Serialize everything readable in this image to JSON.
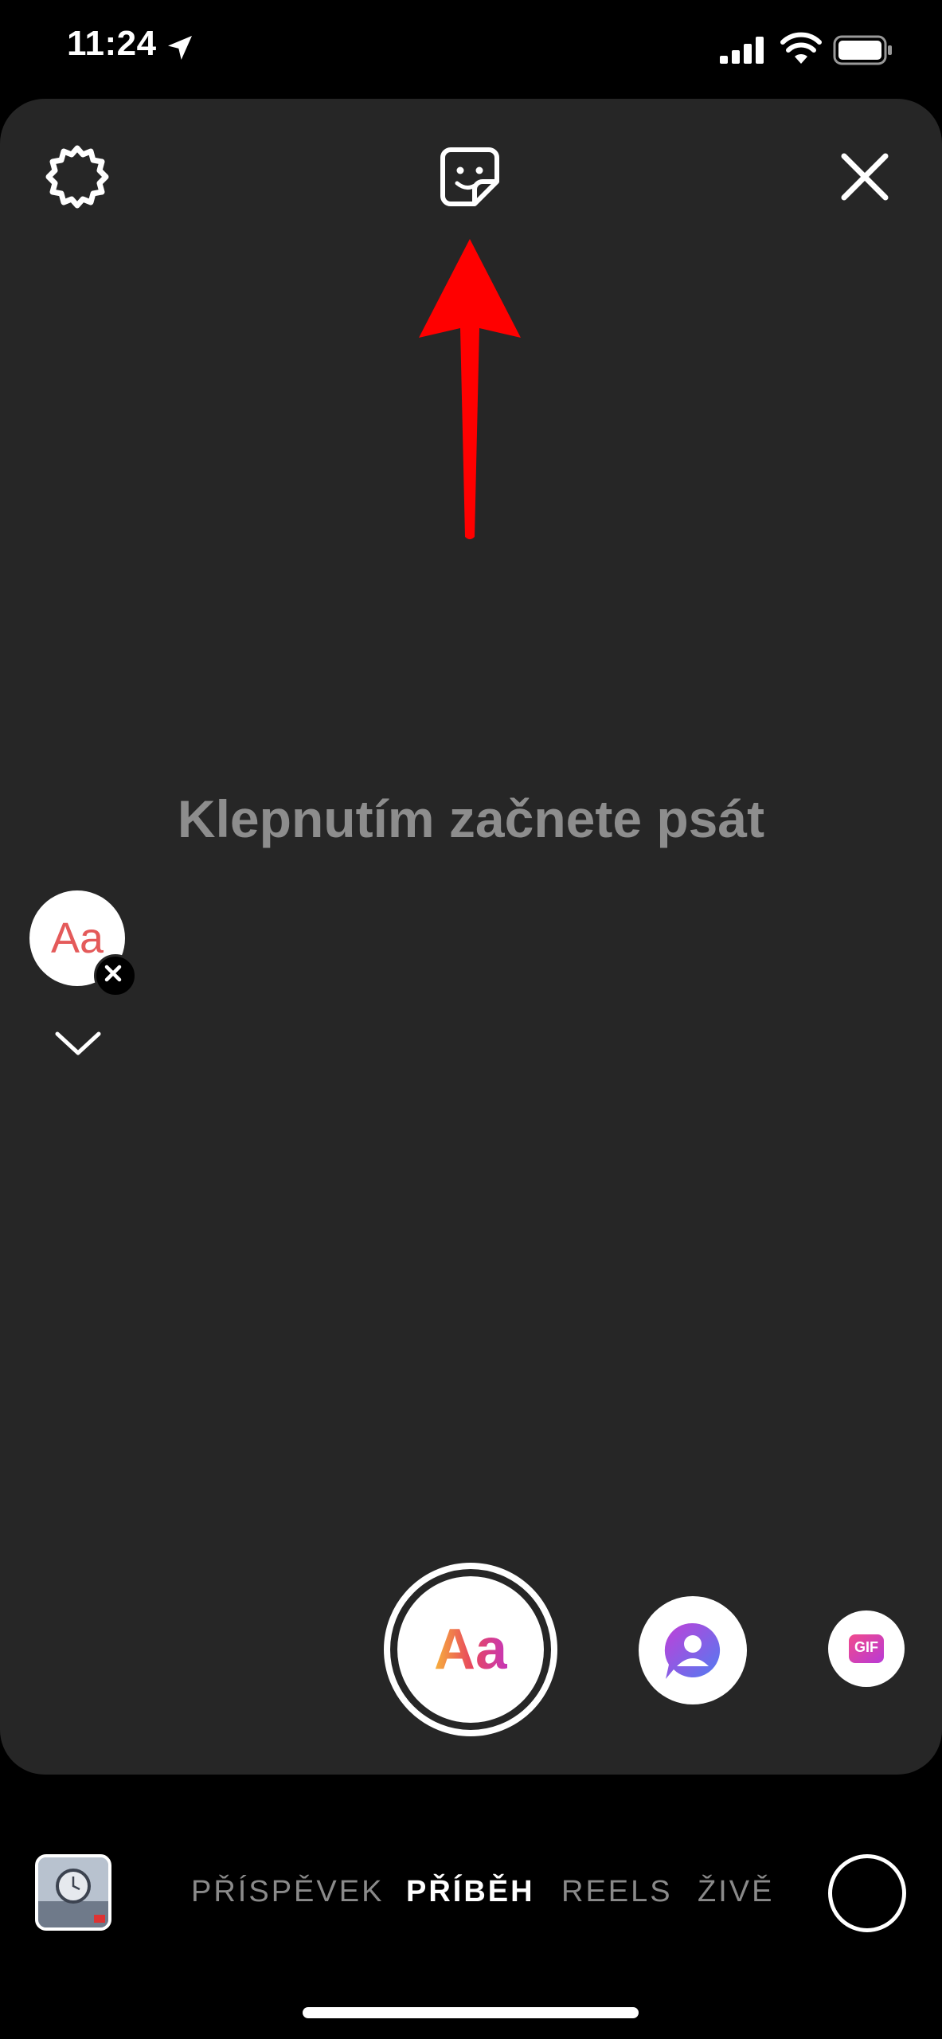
{
  "status_bar": {
    "time": "11:24",
    "location_icon": "location-arrow-icon",
    "signal_icon": "cellular-signal-icon",
    "wifi_icon": "wifi-icon",
    "battery_icon": "battery-icon"
  },
  "top_bar": {
    "settings_icon": "gear-icon",
    "sticker_icon": "sticker-icon",
    "close_icon": "close-icon"
  },
  "annotation": {
    "arrow_color": "#ff0000"
  },
  "canvas": {
    "placeholder": "Klepnutím začnete psát",
    "font_chip_label": "Aa"
  },
  "create_options": {
    "text_label": "Aa",
    "mention_icon": "mention-icon",
    "gif_label": "GIF"
  },
  "modes": [
    {
      "label": "PŘÍSPĚVEK",
      "active": false
    },
    {
      "label": "PŘÍBĚH",
      "active": true
    },
    {
      "label": "REELS",
      "active": false
    },
    {
      "label": "ŽIVĚ",
      "active": false
    }
  ],
  "colors": {
    "background": "#000000",
    "canvas": "#262626",
    "placeholder_text": "#8d8d8d",
    "accent_gradient": [
      "#f7b23b",
      "#e8485d",
      "#c636b6"
    ]
  }
}
